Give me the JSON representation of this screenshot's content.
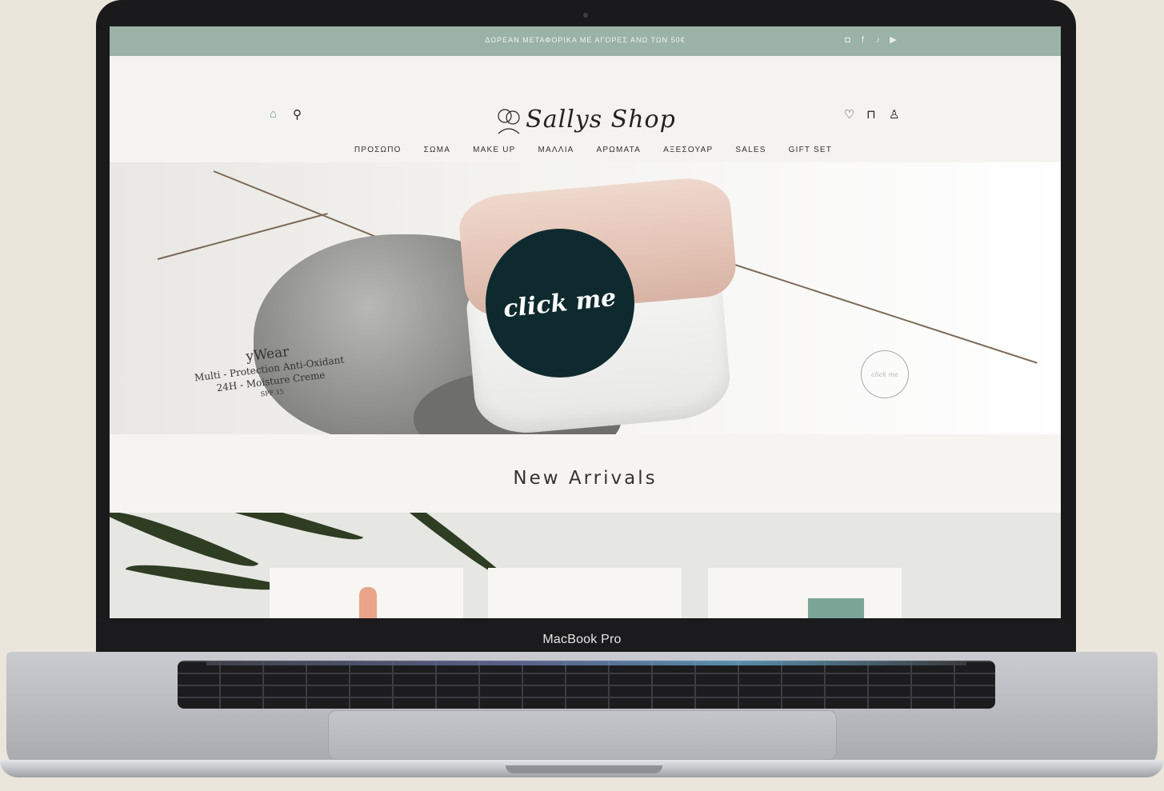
{
  "device": {
    "model_label": "MacBook Pro"
  },
  "announcement": {
    "text": "ΔΩΡΕΑΝ ΜΕΤΑΦΟΡΙΚΑ ΜΕ ΑΓΟΡΕΣ ΑΝΩ ΤΩΝ 50€",
    "social_icons": [
      "instagram-icon",
      "facebook-icon",
      "tiktok-icon",
      "youtube-icon"
    ]
  },
  "header": {
    "logo_text": "Sallys Shop",
    "left_icons": [
      "home-icon",
      "search-icon"
    ],
    "right_icons": [
      "heart-icon",
      "bag-icon",
      "user-icon"
    ]
  },
  "nav": {
    "items": [
      "ΠΡΟΣΩΠΟ",
      "ΣΩΜΑ",
      "MAKE UP",
      "ΜΑΛΛΙΑ",
      "ΑΡΩΜΑΤΑ",
      "ΑΞΕΣΟΥΑΡ",
      "SALES",
      "GIFT SET"
    ]
  },
  "hero": {
    "cta_label": "click me",
    "cta_small_label": "click me",
    "product_label": {
      "line1": "yWear",
      "line2": "Multi - Protection Anti-Oxidant",
      "line3": "24H - Moisture Creme",
      "line4": "SPF 15"
    }
  },
  "arrivals": {
    "title": "New Arrivals"
  },
  "colors": {
    "announcement_bg": "#9bb2a6",
    "cta_bg": "#0e2a2e",
    "page_bg": "#f6f4f1"
  }
}
